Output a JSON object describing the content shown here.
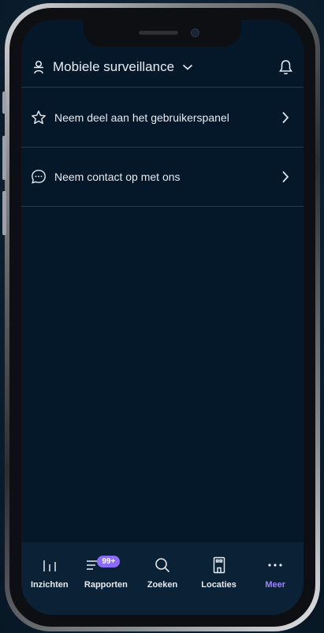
{
  "header": {
    "title": "Mobiele surveillance",
    "profile_icon": "user-icon",
    "dropdown_icon": "chevron-down-icon",
    "notification_icon": "bell-icon"
  },
  "menu": {
    "items": [
      {
        "label": "Neem deel aan het gebruikerspanel",
        "icon": "star-icon"
      },
      {
        "label": "Neem contact op met ons",
        "icon": "chat-bubble-icon"
      }
    ]
  },
  "bottom_nav": {
    "items": [
      {
        "label": "Inzichten",
        "icon": "bar-chart-icon"
      },
      {
        "label": "Rapporten",
        "icon": "list-icon",
        "badge": "99+"
      },
      {
        "label": "Zoeken",
        "icon": "search-icon"
      },
      {
        "label": "Locaties",
        "icon": "building-icon"
      },
      {
        "label": "Meer",
        "icon": "more-icon",
        "active": true
      }
    ]
  },
  "colors": {
    "background": "#05182a",
    "nav_background": "#0a2136",
    "accent": "#9d84ff",
    "badge": "#8b6cff",
    "divider": "#26394a"
  }
}
